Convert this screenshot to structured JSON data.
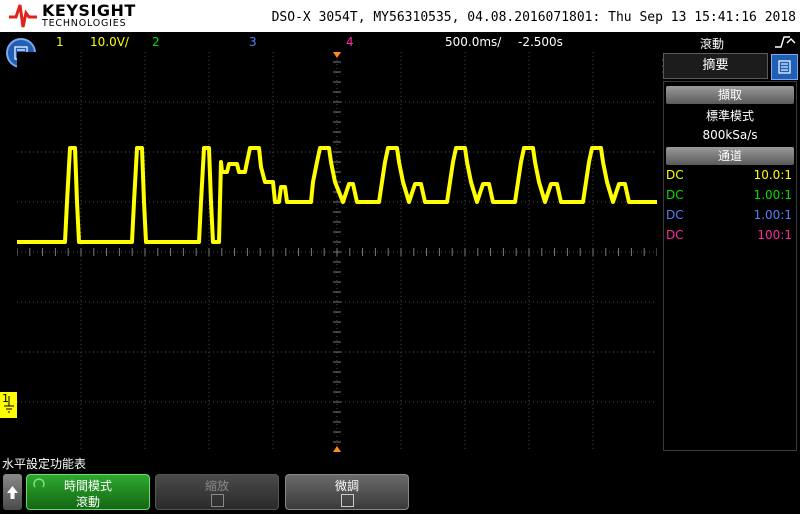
{
  "header": {
    "brand_name": "KEYSIGHT",
    "brand_sub": "TECHNOLOGIES",
    "device_info": "DSO-X 3054T, MY56310535, 04.08.2016071801: Thu Sep 13 15:41:16 2018"
  },
  "status_bar": {
    "ch1_number": "1",
    "ch1_scale": "10.0V/",
    "ch2_number": "2",
    "ch3_number": "3",
    "ch4_number": "4",
    "time_scale": "500.0ms/",
    "delay": "-2.500s",
    "mode": "滾動"
  },
  "right_panel": {
    "summary_tab": "摘要",
    "acquire_header": "擷取",
    "acquire_mode": "標準模式",
    "sample_rate": "800kSa/s",
    "channels_header": "通道",
    "channels": [
      {
        "coupling": "DC",
        "ratio": "10.0:1",
        "color": "#ffff00"
      },
      {
        "coupling": "DC",
        "ratio": "1.00:1",
        "color": "#00e000"
      },
      {
        "coupling": "DC",
        "ratio": "1.00:1",
        "color": "#5a7cff"
      },
      {
        "coupling": "DC",
        "ratio": "100:1",
        "color": "#ff2aa0"
      }
    ]
  },
  "softkeys": {
    "menu_title": "水平設定功能表",
    "time_mode_label": "時間模式",
    "time_mode_value": "滾動",
    "zoom_label": "縮放",
    "fine_label": "微調"
  },
  "colors": {
    "ch1": "#ffff00",
    "ch2": "#00e000",
    "ch3": "#5a7cff",
    "ch4": "#ff2aa0",
    "accent_blue": "#1f5fb8",
    "softkey_green": "#1e8a1e"
  },
  "channel1_marker": "1"
}
